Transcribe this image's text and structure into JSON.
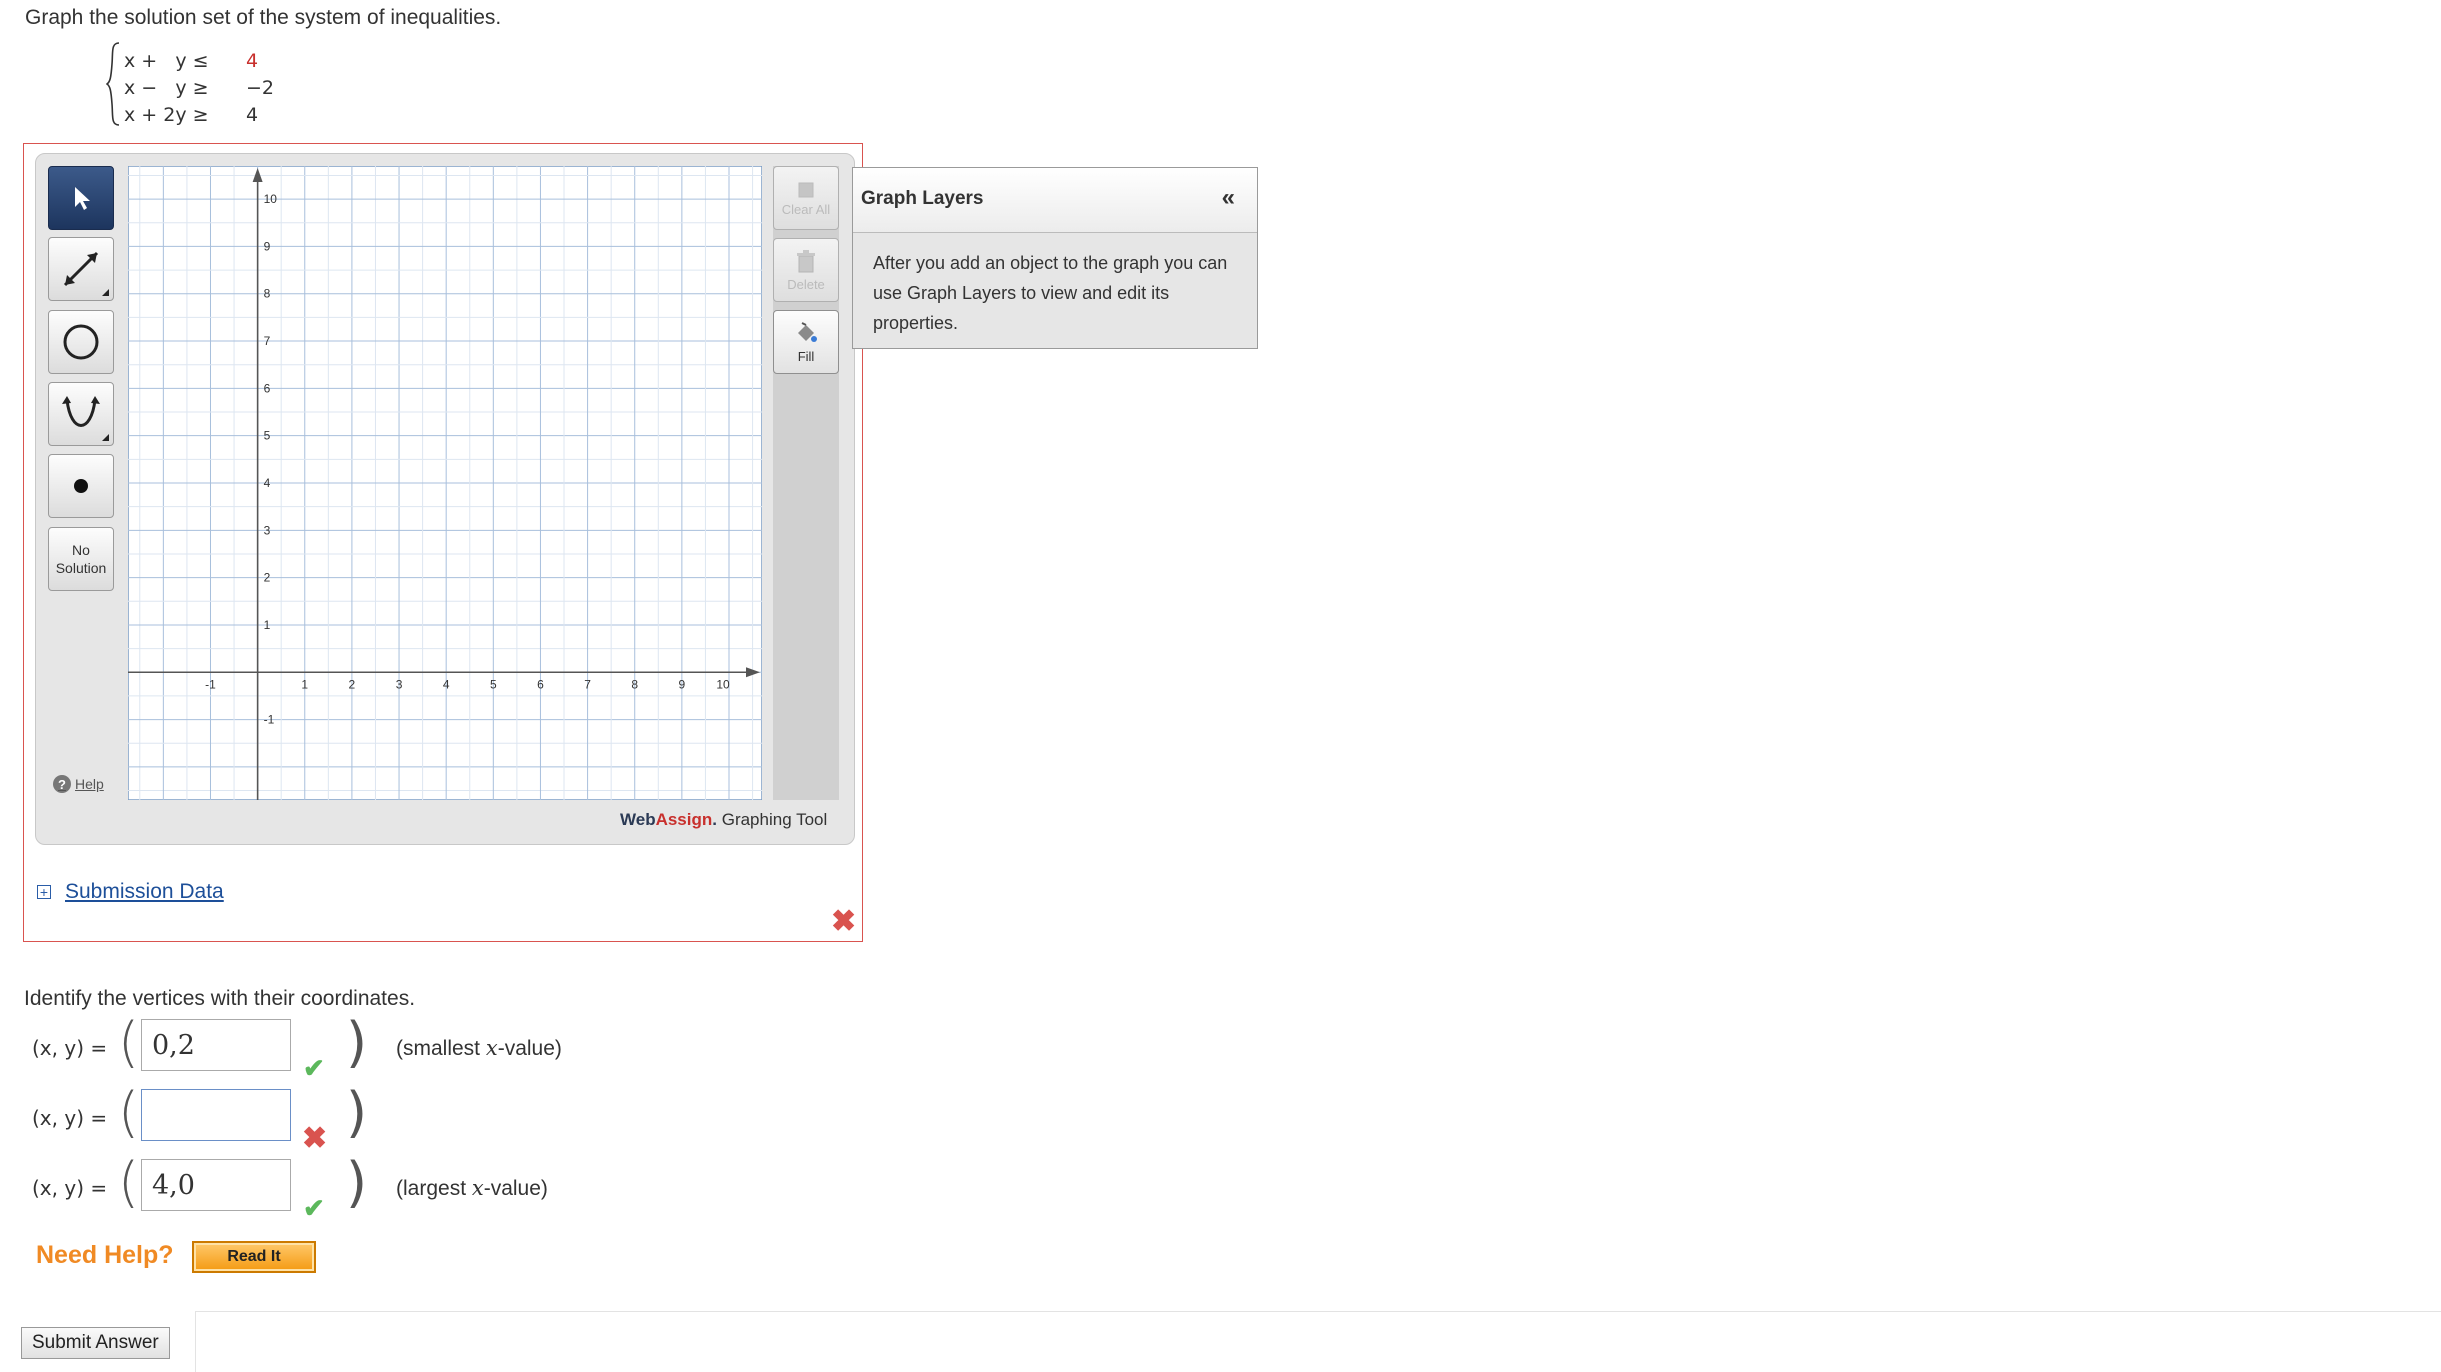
{
  "prompt": "Graph the solution set of the system of inequalities.",
  "system": [
    {
      "lhs": "x +   y ≤",
      "rhs": "4",
      "rhs_color": "#c8302d"
    },
    {
      "lhs": "x −   y ≥",
      "rhs": "−2",
      "rhs_color": "#333333"
    },
    {
      "lhs": "x + 2y ≥",
      "rhs": "4",
      "rhs_color": "#333333"
    }
  ],
  "tools": {
    "select_icon": "arrow-pointer-icon",
    "line_icon": "line-segment-icon",
    "circle_icon": "circle-icon",
    "parabola_icon": "parabola-icon",
    "point_icon": "point-icon",
    "no_solution_label": "No\nSolution",
    "help_label": "Help"
  },
  "graph": {
    "x_ticks": [
      "-1",
      "1",
      "2",
      "3",
      "4",
      "5",
      "6",
      "7",
      "8",
      "9",
      "10"
    ],
    "y_ticks": [
      "10",
      "9",
      "8",
      "7",
      "6",
      "5",
      "4",
      "3",
      "2",
      "1",
      "-1"
    ]
  },
  "right_tools": {
    "clear_all_label": "Clear All",
    "delete_label": "Delete",
    "fill_label": "Fill"
  },
  "brand": {
    "web": "Web",
    "assign": "Assign",
    "dot": ".",
    "rest": " Graphing Tool"
  },
  "layers": {
    "title": "Graph Layers",
    "collapse": "«",
    "body": "After you add an object to the graph you can use Graph Layers to view and edit its properties."
  },
  "submission": {
    "label": "Submission Data",
    "expand": "+"
  },
  "graph_status": "✖",
  "identify": "Identify the vertices with their coordinates.",
  "vertices": [
    {
      "label": "(x, y) =",
      "value": "0,2",
      "status": "✔",
      "note_pre": "(smallest ",
      "note_var": "x",
      "note_post": "-value)"
    },
    {
      "label": "(x, y) =",
      "value": "",
      "status": "✖",
      "note_pre": "",
      "note_var": "",
      "note_post": ""
    },
    {
      "label": "(x, y) =",
      "value": "4,0",
      "status": "✔",
      "note_pre": "(largest ",
      "note_var": "x",
      "note_post": "-value)"
    }
  ],
  "paren_open": "(",
  "paren_close": ")",
  "need_help": "Need Help?",
  "read_it": "Read It",
  "submit": "Submit Answer",
  "colors": {
    "accent_red": "#c8302d",
    "check_green": "#5cb85c",
    "orange": "#f08a24"
  }
}
